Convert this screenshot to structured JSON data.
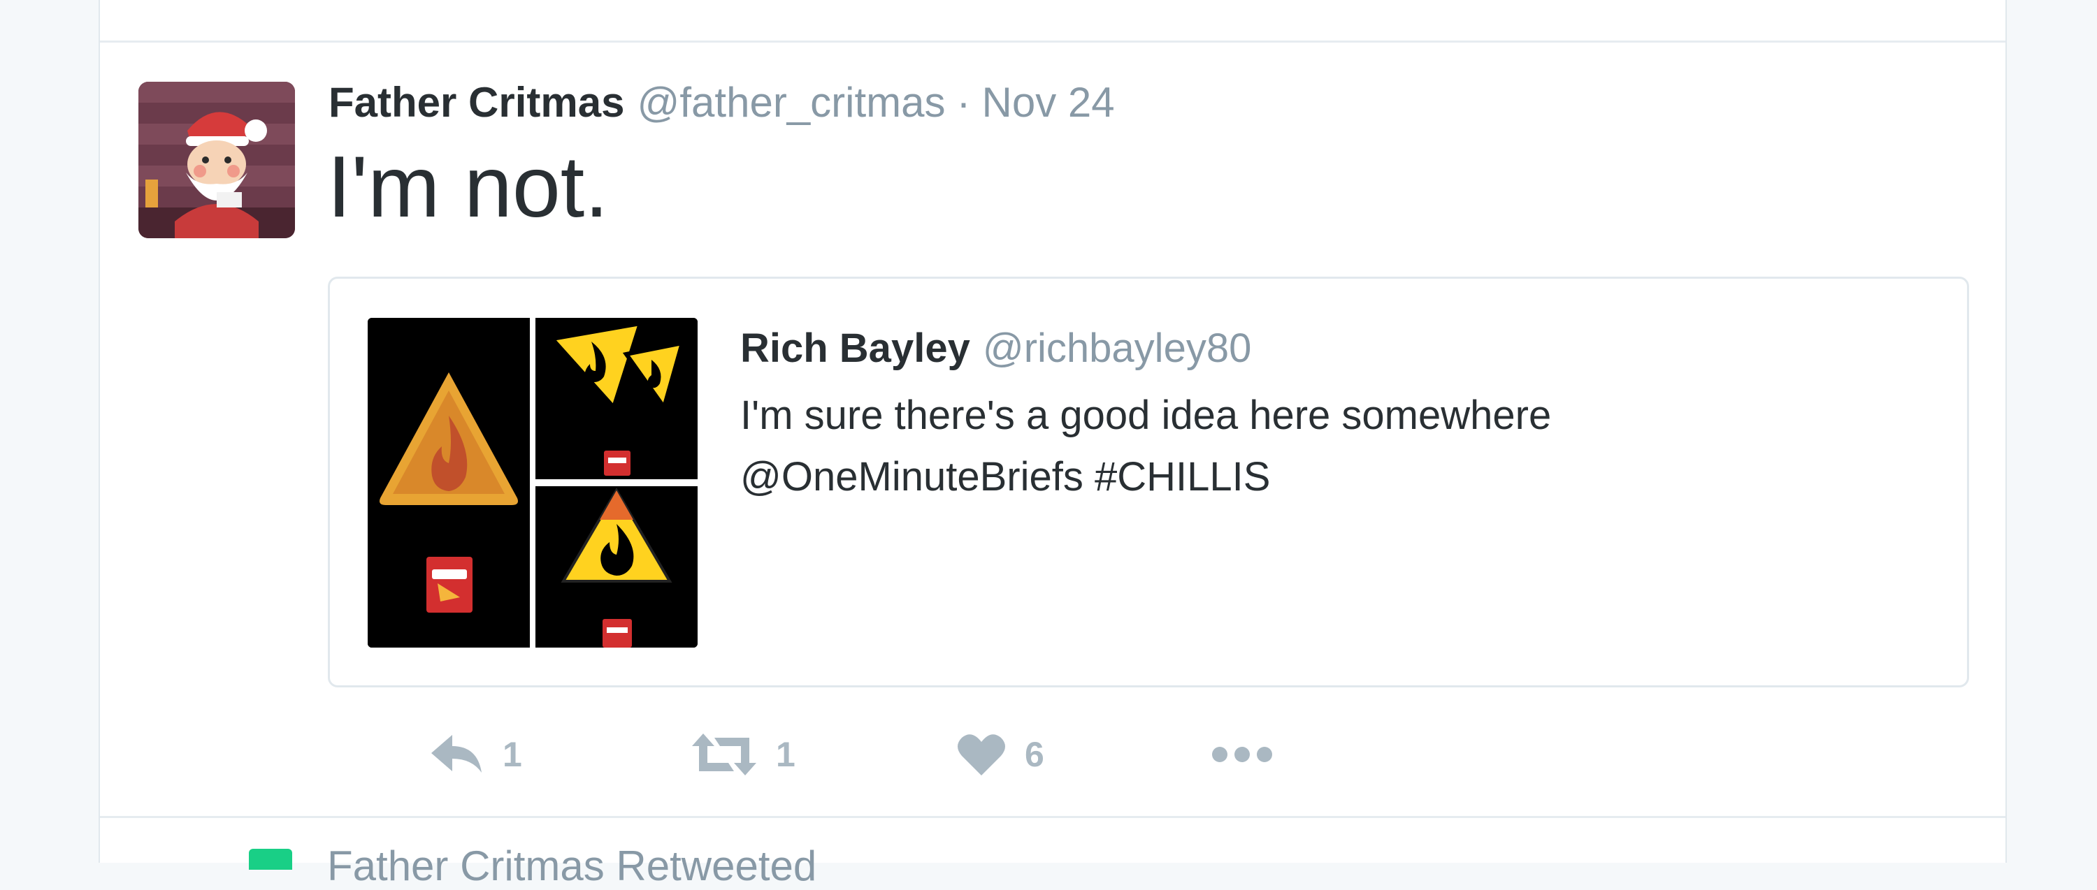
{
  "tweet": {
    "fullname": "Father Critmas",
    "username": "@father_critmas",
    "separator": "·",
    "time": "Nov 24",
    "text": "I'm not.",
    "avatar_icon": "santa-avatar"
  },
  "quoted_tweet": {
    "fullname": "Rich Bayley",
    "username": "@richbayley80",
    "text_line1": "I'm sure there's a good idea here somewhere",
    "text_line2": "@OneMinuteBriefs #CHILLIS",
    "media_icons": [
      "chip-warning-sign-image",
      "double-warning-sign-image",
      "flame-warning-sign-image"
    ]
  },
  "actions": {
    "reply_count": "1",
    "retweet_count": "1",
    "like_count": "6",
    "icons": [
      "reply-icon",
      "retweet-icon",
      "heart-icon",
      "more-icon"
    ]
  },
  "next_tweet": {
    "text": "Father Critmas Retweeted"
  },
  "colors": {
    "page_bg": "#f5f8fa",
    "card_bg": "#ffffff",
    "border": "#e1e8ed",
    "text_primary": "#292f33",
    "text_secondary": "#8899a6",
    "action_gray": "#aab8c2",
    "retweet_green": "#19cf86"
  }
}
